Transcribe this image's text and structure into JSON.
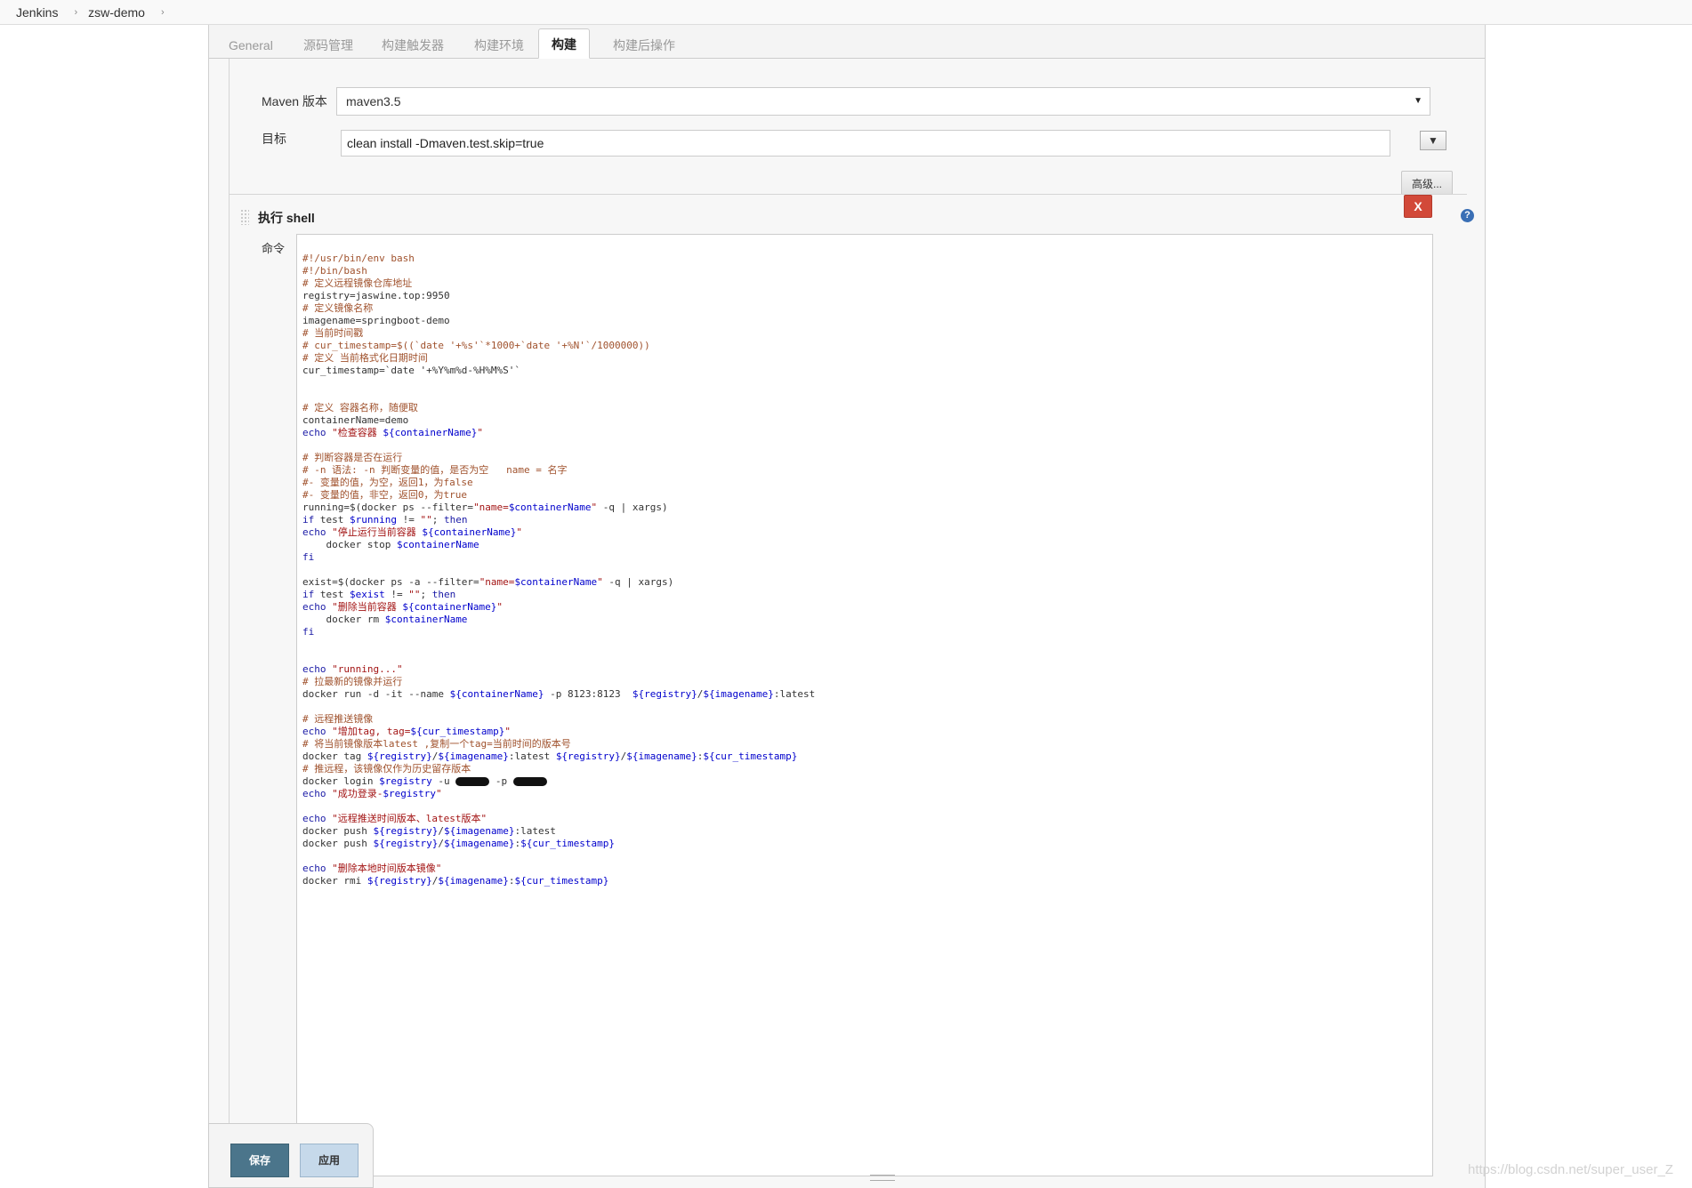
{
  "breadcrumb": {
    "items": [
      "Jenkins",
      "zsw-demo"
    ],
    "separator": "›"
  },
  "tabs": [
    "General",
    "源码管理",
    "构建触发器",
    "构建环境",
    "构建",
    "构建后操作"
  ],
  "active_tab": "构建",
  "maven": {
    "version_label": "Maven 版本",
    "version_value": "maven3.5",
    "goal_label": "目标",
    "goal_value": "clean install -Dmaven.test.skip=true",
    "expand_label": "▼",
    "advanced_label": "高级..."
  },
  "shell": {
    "title": "执行 shell",
    "delete_label": "X",
    "help_label": "?",
    "command_label": "命令",
    "code_lines": [
      "#!/usr/bin/env bash",
      "#!/bin/bash",
      "# 定义远程镜像仓库地址",
      "registry=jaswine.top:9950",
      "# 定义镜像名称",
      "imagename=springboot-demo",
      "# 当前时间戳",
      "# cur_timestamp=$((`date '+%s'`*1000+`date '+%N'`/1000000))",
      "# 定义 当前格式化日期时间",
      "cur_timestamp=`date '+%Y%m%d-%H%M%S'`",
      "",
      "",
      "# 定义 容器名称，随便取",
      "containerName=demo",
      "echo \"检查容器 ${containerName}\"",
      "",
      "# 判断容器是否在运行",
      "# -n 语法: -n 判断变量的值，是否为空   name = 名字",
      "#- 变量的值，为空，返回1，为false",
      "#- 变量的值，非空，返回0，为true",
      "running=$(docker ps --filter=\"name=$containerName\" -q | xargs)",
      "if test $running != \"\"; then",
      "echo \"停止运行当前容器 ${containerName}\"",
      "    docker stop $containerName",
      "fi",
      "",
      "exist=$(docker ps -a --filter=\"name=$containerName\" -q | xargs)",
      "if test $exist != \"\"; then",
      "echo \"删除当前容器 ${containerName}\"",
      "    docker rm $containerName",
      "fi",
      "",
      "",
      "echo \"running...\"",
      "# 拉最新的镜像并运行",
      "docker run -d -it --name ${containerName} -p 8123:8123  ${registry}/${imagename}:latest",
      "",
      "# 远程推送镜像",
      "echo \"增加tag, tag=${cur_timestamp}\"",
      "# 将当前镜像版本latest ,复制一个tag=当前时间的版本号",
      "docker tag ${registry}/${imagename}:latest ${registry}/${imagename}:${cur_timestamp}",
      "# 推远程，该镜像仅作为历史留存版本",
      "docker login $registry -u [REDACTED] -p [REDACTED]",
      "echo \"成功登录-$registry\"",
      "",
      "echo \"远程推送时间版本、latest版本\"",
      "docker push ${registry}/${imagename}:latest",
      "docker push ${registry}/${imagename}:${cur_timestamp}",
      "",
      "echo \"删除本地时间版本镜像\"",
      "docker rmi ${registry}/${imagename}:${cur_timestamp}"
    ]
  },
  "footer": {
    "save_label": "保存",
    "apply_label": "应用"
  },
  "watermark": "https://blog.csdn.net/super_user_Z"
}
